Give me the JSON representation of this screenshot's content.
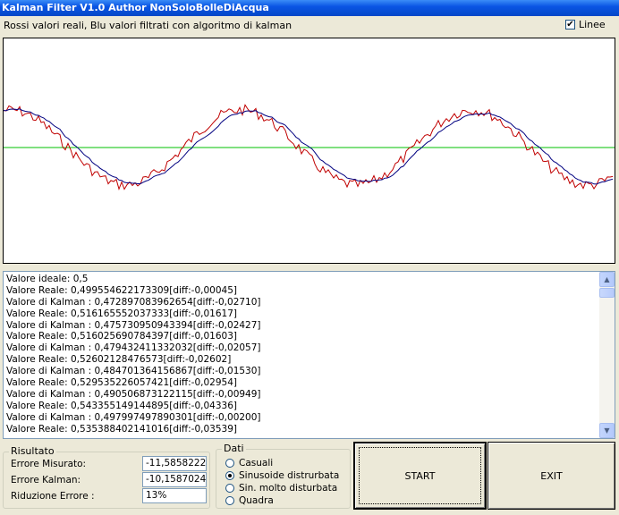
{
  "window": {
    "title": "Kalman Filter V1.0 Author NonSoloBolleDiAcqua"
  },
  "header": {
    "subtitle": "Rossi valori reali, Blu valori filtrati con algoritmo di kalman",
    "linee_label": "Linee",
    "linee_checked": true
  },
  "plot": {
    "colors": {
      "real": "#c00000",
      "kalman": "#000080",
      "ideal": "#00c000",
      "background": "#ffffff"
    }
  },
  "log": {
    "lines": [
      "Valore ideale: 0,5",
      "Valore Reale: 0,499554622173309[diff:-0,00045]",
      "Valore di Kalman : 0,472897083962654[diff:-0,02710]",
      "Valore Reale: 0,516165552037333[diff:-0,01617]",
      "Valore di Kalman : 0,475730950943394[diff:-0,02427]",
      "Valore Reale: 0,516025690784397[diff:-0,01603]",
      "Valore di Kalman : 0,479432411332032[diff:-0,02057]",
      "Valore Reale: 0,52602128476573[diff:-0,02602]",
      "Valore di Kalman : 0,484701364156867[diff:-0,01530]",
      "Valore Reale: 0,529535226057421[diff:-0,02954]",
      "Valore di Kalman : 0,490506873122115[diff:-0,00949]",
      "Valore Reale: 0,543355149144895[diff:-0,04336]",
      "Valore di Kalman : 0,497997497890301[diff:-0,00200]",
      "Valore Reale: 0,535388402141016[diff:-0,03539]"
    ]
  },
  "risultato": {
    "title": "Risultato",
    "errore_misurato_label": "Errore Misurato:",
    "errore_misurato_value": "-11,5858222",
    "errore_kalman_label": "Errore Kalman:",
    "errore_kalman_value": "-10,1587024",
    "riduzione_label": "Riduzione Errore :",
    "riduzione_value": "13%"
  },
  "dati": {
    "title": "Dati",
    "options": [
      "Casuali",
      "Sinusoide distrurbata",
      "Sin. molto disturbata",
      "Quadra"
    ],
    "selected_index": 1
  },
  "buttons": {
    "start": "START",
    "exit": "EXIT"
  }
}
